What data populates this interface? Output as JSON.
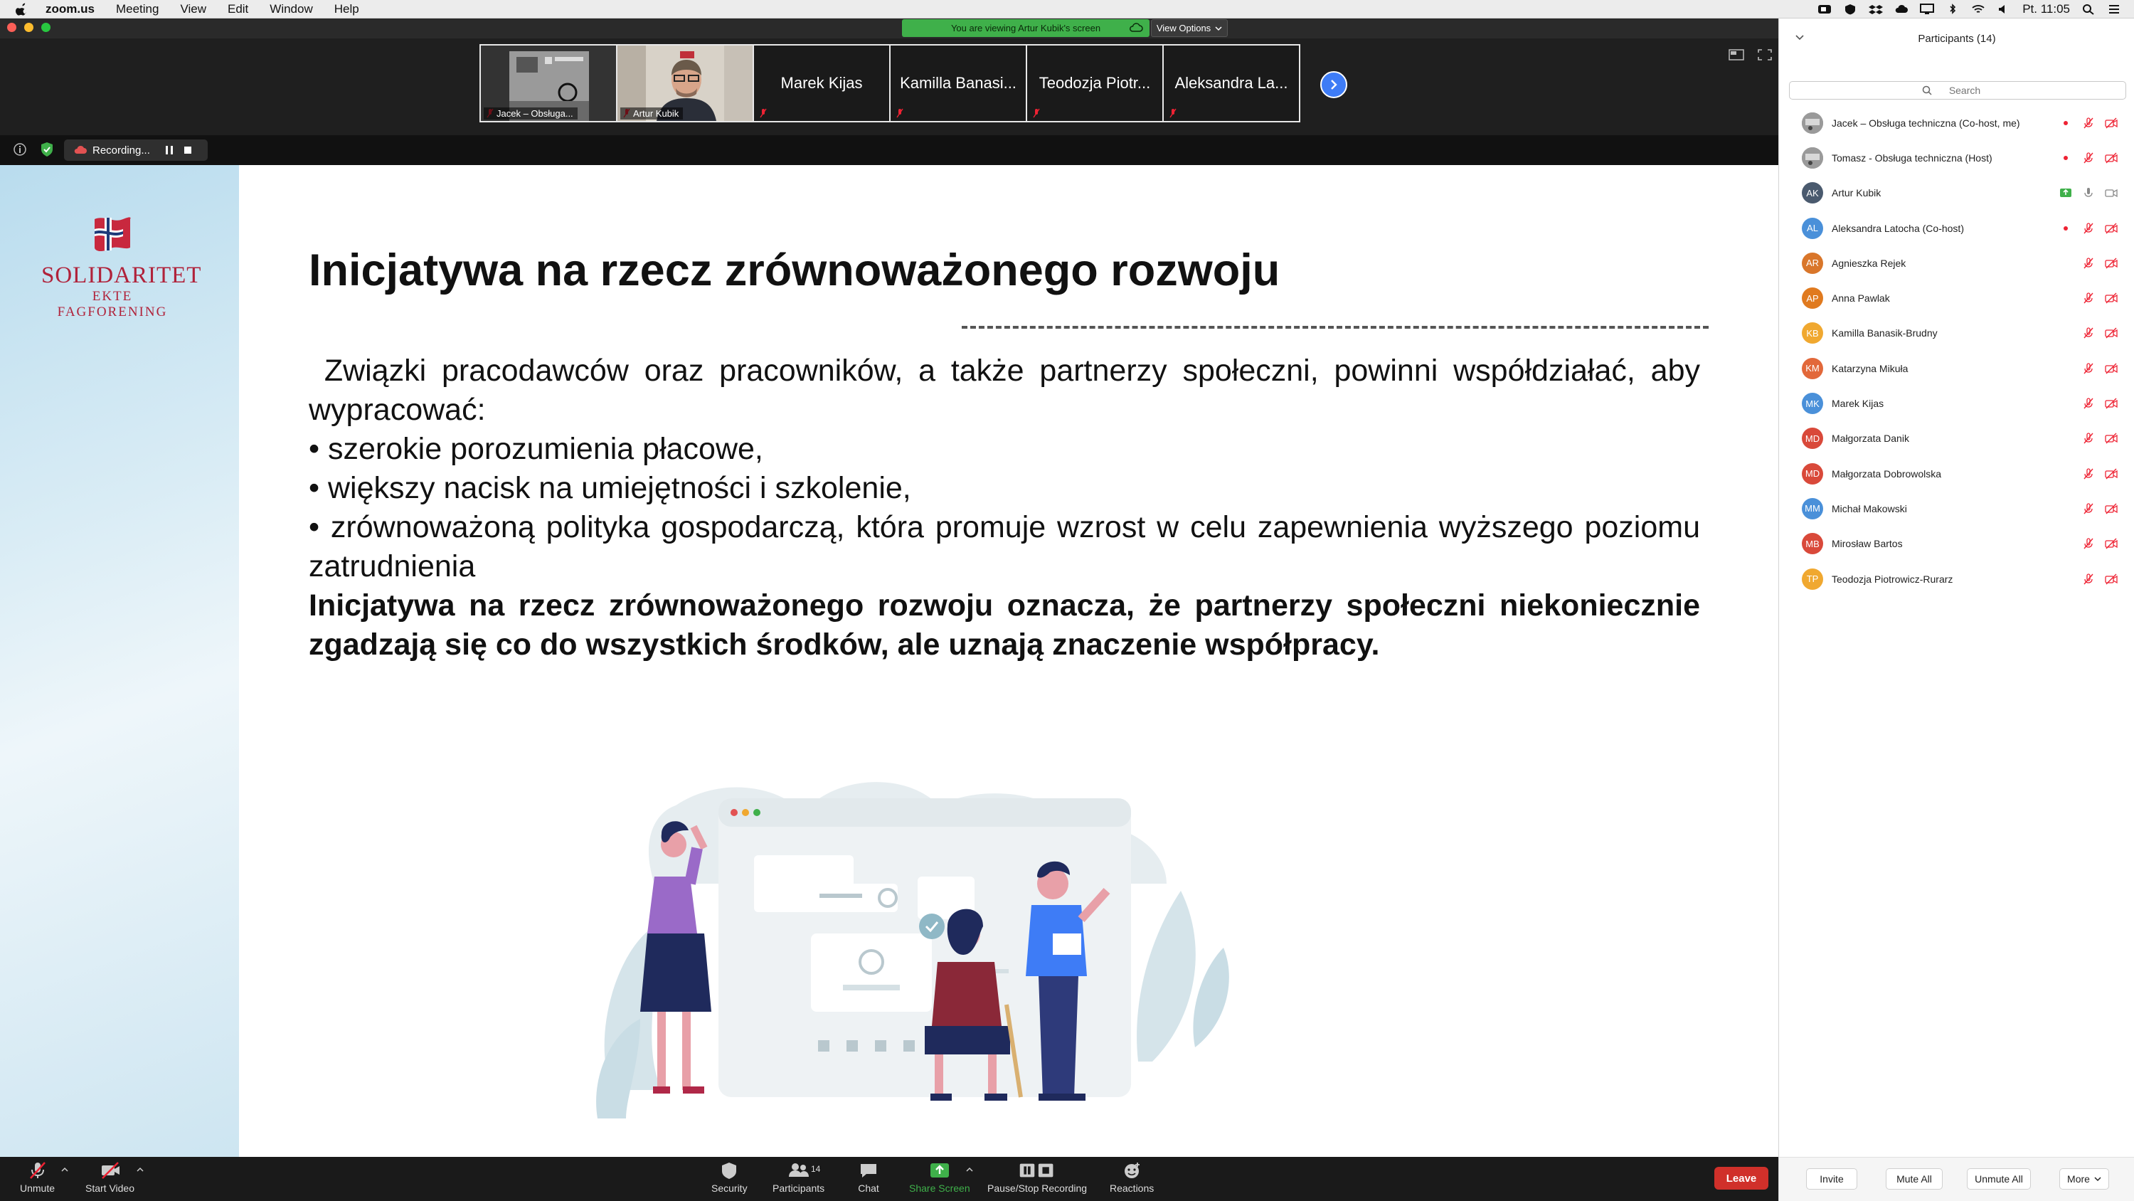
{
  "menubar": {
    "app": "zoom.us",
    "items": [
      "Meeting",
      "View",
      "Edit",
      "Window",
      "Help"
    ],
    "clock": "Pt. 11:05"
  },
  "banner": {
    "viewing_text": "You are viewing Artur Kubik's screen",
    "view_options": "View Options"
  },
  "thumbnails": [
    {
      "label": "Jacek – Obsługa...",
      "kind": "video"
    },
    {
      "label": "Artur Kubik",
      "kind": "video"
    },
    {
      "label": "Marek Kijas",
      "kind": "name"
    },
    {
      "label": "Kamilla Banasi...",
      "kind": "name"
    },
    {
      "label": "Teodozja Piotr...",
      "kind": "name"
    },
    {
      "label": "Aleksandra La...",
      "kind": "name"
    }
  ],
  "recording": {
    "label": "Recording..."
  },
  "slide": {
    "logo_title": "SOLIDARITET",
    "logo_sub": "EKTE FAGFORENING",
    "title": "Inicjatywa na rzecz zrównoważonego rozwoju",
    "intro": " Związki pracodawców oraz pracowników, a także partnerzy społeczni, powinni współdziałać, aby wypracować:",
    "bullets": [
      "• szerokie porozumienia płacowe,",
      "• większy nacisk na umiejętności i szkolenie,",
      "• zrównoważoną polityka gospodarczą, która promuje wzrost w celu zapewnienia wyższego poziomu zatrudnienia"
    ],
    "conclusion": "Inicjatywa na rzecz zrównoważonego rozwoju oznacza, że partnerzy społeczni niekoniecznie zgadzają się co do wszystkich środków, ale uznają znaczenie współpracy."
  },
  "toolbar": {
    "unmute": "Unmute",
    "start_video": "Start Video",
    "security": "Security",
    "participants": "Participants",
    "participants_count": "14",
    "chat": "Chat",
    "share_screen": "Share Screen",
    "pause_stop_recording": "Pause/Stop Recording",
    "reactions": "Reactions",
    "leave": "Leave"
  },
  "panel": {
    "title": "Participants (14)",
    "search_placeholder": "Search",
    "participants": [
      {
        "initials": "",
        "name": "Jacek – Obsługa techniczna (Co-host, me)",
        "color": "#8a8a8a",
        "photo": true,
        "hand": false,
        "rec": true
      },
      {
        "initials": "",
        "name": "Tomasz - Obsługa techniczna (Host)",
        "color": "#8a8a8a",
        "photo": true,
        "hand": false,
        "rec": true
      },
      {
        "initials": "AK",
        "name": "Artur Kubik",
        "color": "#4a5a6e",
        "photo": false,
        "hand": false,
        "rec": false,
        "sharing": true
      },
      {
        "initials": "AL",
        "name": "Aleksandra Latocha (Co-host)",
        "color": "#4a90d9",
        "photo": false,
        "hand": false,
        "rec": true
      },
      {
        "initials": "AR",
        "name": "Agnieszka Rejek",
        "color": "#d9762a",
        "photo": false
      },
      {
        "initials": "AP",
        "name": "Anna Pawlak",
        "color": "#e07a1f",
        "photo": false
      },
      {
        "initials": "KB",
        "name": "Kamilla Banasik-Brudny",
        "color": "#f0a830",
        "photo": false
      },
      {
        "initials": "KM",
        "name": "Katarzyna Mikuła",
        "color": "#e2683a",
        "photo": false
      },
      {
        "initials": "MK",
        "name": "Marek Kijas",
        "color": "#4a90d9",
        "photo": false
      },
      {
        "initials": "MD",
        "name": "Małgorzata Danik",
        "color": "#d9493a",
        "photo": false
      },
      {
        "initials": "MD",
        "name": "Małgorzata Dobrowolska",
        "color": "#d9493a",
        "photo": false
      },
      {
        "initials": "MM",
        "name": "Michał Makowski",
        "color": "#4a90d9",
        "photo": false
      },
      {
        "initials": "MB",
        "name": "Mirosław Bartos",
        "color": "#d9493a",
        "photo": false
      },
      {
        "initials": "TP",
        "name": "Teodozja Piotrowicz-Rurarz",
        "color": "#f0a830",
        "photo": false
      }
    ],
    "invite": "Invite",
    "mute_all": "Mute All",
    "unmute_all": "Unmute All",
    "more": "More"
  },
  "colors": {
    "accent_green": "#3fb04a",
    "leave_red": "#d0302a",
    "blue_next": "#3e7cf6",
    "logo_red": "#b0223a"
  }
}
